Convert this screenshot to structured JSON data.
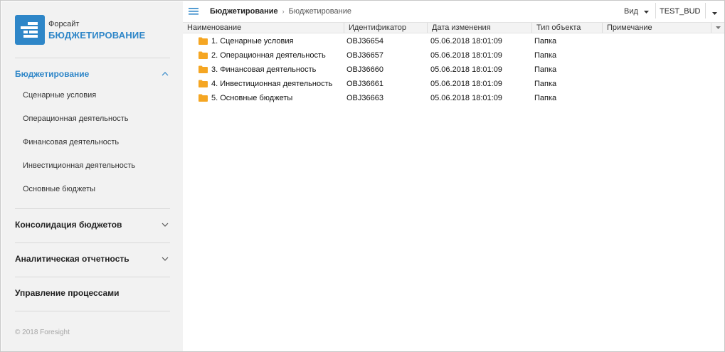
{
  "app": {
    "logo_line1": "Форсайт",
    "logo_line2": "БЮДЖЕТИРОВАНИЕ",
    "accent": "#2e86c8",
    "folder_color": "#f5a623"
  },
  "sidebar": {
    "active_section": "Бюджетирование",
    "sub_items": [
      "Сценарные условия",
      "Операционная деятельность",
      "Финансовая деятельность",
      "Инвестиционная деятельность",
      "Основные бюджеты"
    ],
    "sections": [
      "Консолидация бюджетов",
      "Аналитическая отчетность",
      "Управление процессами"
    ],
    "copyright": "© 2018 Foresight"
  },
  "topbar": {
    "breadcrumb_root": "Бюджетирование",
    "breadcrumb_current": "Бюджетирование",
    "view_label": "Вид",
    "user": "TEST_BUD"
  },
  "table": {
    "columns": [
      "Наименование",
      "Идентификатор",
      "Дата изменения",
      "Тип объекта",
      "Примечание"
    ],
    "rows": [
      {
        "name": "1. Сценарные условия",
        "id": "OBJ36654",
        "date": "05.06.2018 18:01:09",
        "type": "Папка",
        "note": ""
      },
      {
        "name": "2. Операционная деятельность",
        "id": "OBJ36657",
        "date": "05.06.2018 18:01:09",
        "type": "Папка",
        "note": ""
      },
      {
        "name": "3. Финансовая деятельность",
        "id": "OBJ36660",
        "date": "05.06.2018 18:01:09",
        "type": "Папка",
        "note": ""
      },
      {
        "name": "4. Инвестиционная деятельность",
        "id": "OBJ36661",
        "date": "05.06.2018 18:01:09",
        "type": "Папка",
        "note": ""
      },
      {
        "name": "5. Основные бюджеты",
        "id": "OBJ36663",
        "date": "05.06.2018 18:01:09",
        "type": "Папка",
        "note": ""
      }
    ]
  }
}
